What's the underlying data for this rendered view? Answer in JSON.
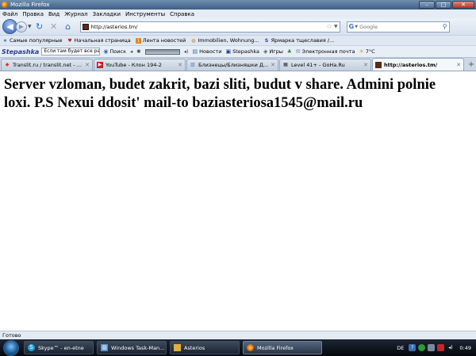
{
  "window": {
    "title": "Mozilla Firefox"
  },
  "menu": [
    "Файл",
    "Правка",
    "Вид",
    "Журнал",
    "Закладки",
    "Инструменты",
    "Справка"
  ],
  "nav": {
    "url": "http://asterios.tm/",
    "search_engine": "G",
    "search_placeholder": "Google"
  },
  "bookmarks": [
    {
      "label": "Самые популярные",
      "icon": "star-folder-icon",
      "color": "#3a6fb0"
    },
    {
      "label": "Начальная страница",
      "icon": "heart-icon",
      "color": "#c0282d"
    },
    {
      "label": "Лента новостей",
      "icon": "rss-icon",
      "color": "#e8841a"
    },
    {
      "label": "Immobilien, Wohnung...",
      "icon": "globe-icon",
      "color": "#b08a2a"
    },
    {
      "label": "Ярмарка тщеславия /...",
      "icon": "s-logo-icon",
      "color": "#2a3d8f"
    }
  ],
  "stepashka": {
    "logo": "Stepashka",
    "input_value": "Если там будет все pat",
    "search": "Поиск",
    "news": "Новости",
    "stepashka_link": "Stepashka",
    "games": "Игры",
    "email": "Электронная почта",
    "temperature": "7°C"
  },
  "tabs": [
    {
      "label": "Translit.ru / translit.net - т...",
      "icon_color": "#d33a2c",
      "active": false
    },
    {
      "label": "YouTube - Клон 194-2",
      "icon_color": "#cc1f1f",
      "active": false
    },
    {
      "label": "Близнецы/Близняшки Д...",
      "icon_color": "#5a7fb8",
      "active": false
    },
    {
      "label": "Level 41+ - GoHa.Ru",
      "icon_color": "#2b2b2b",
      "active": false
    },
    {
      "label": "http://asterios.tm/",
      "icon_color": "#5a2a16",
      "active": true
    }
  ],
  "content": {
    "message": "Server vzloman, budet zakrit, bazi sliti, budut v share. Admini polnie loxi. P.S Nexui ddosit' mail-to baziasteriosa1545@mail.ru"
  },
  "status": "Готово",
  "taskbar": {
    "tasks": [
      {
        "label": "Skype™ - en-etne",
        "active": false,
        "icon_color": "#1ea4e0"
      },
      {
        "label": "Windows Task-Man...",
        "active": false,
        "icon_color": "#5a8fd0"
      },
      {
        "label": "Asterios",
        "active": false,
        "icon_color": "#e0b040"
      },
      {
        "label": "Mozilla Firefox",
        "active": true,
        "icon_color": "#e26a12"
      }
    ],
    "language": "DE",
    "clock": "0:49"
  }
}
